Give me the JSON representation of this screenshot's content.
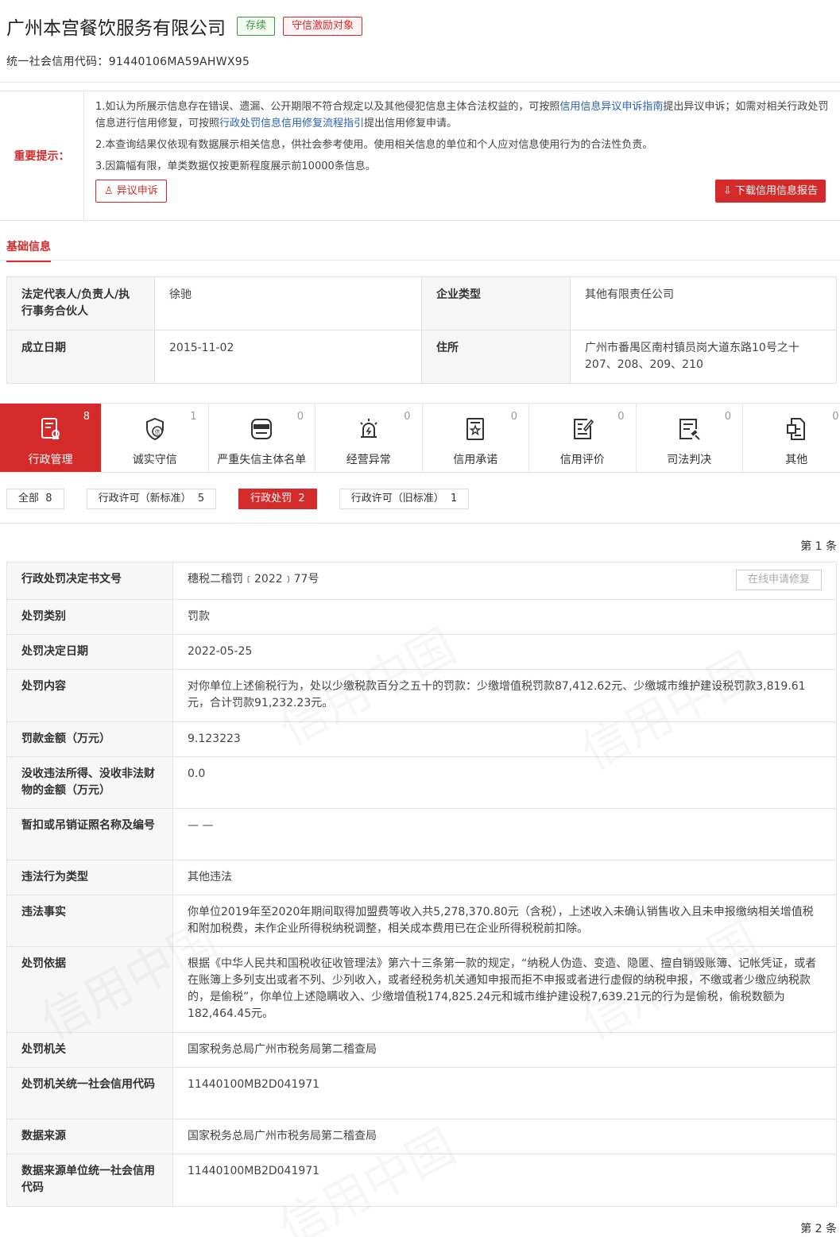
{
  "company": {
    "name": "广州本宫餐饮服务有限公司",
    "status_badge": "存续",
    "honor_badge": "守信激励对象",
    "credit_code": "统一社会信用代码：91440106MA59AHWX95"
  },
  "notice": {
    "label": "重要提示：",
    "p1_a": "1.如认为所展示信息存在错误、遗漏、公开期限不符合规定以及其他侵犯信息主体合法权益的，可按照",
    "p1_link1": "信用信息异议申诉指南",
    "p1_b": "提出异议申诉；如需对相关行政处罚信息进行信用修复，可按照",
    "p1_link2": "行政处罚信息信用修复流程指引",
    "p1_c": "提出信用修复申请。",
    "p2": "2.本查询结果仅依现有数据展示相关信息，供社会参考使用。使用相关信息的单位和个人应对信息使用行为的合法性负责。",
    "p3": "3.因篇幅有限，单类数据仅按更新程度展示前10000条信息。",
    "objection_button": "异议申诉",
    "download_button": "下载信用信息报告"
  },
  "basic": {
    "tab": "基础信息",
    "legal_rep_label": "法定代表人/负责人/执行事务合伙人",
    "legal_rep_value": "徐驰",
    "type_label": "企业类型",
    "type_value": "其他有限责任公司",
    "founded_label": "成立日期",
    "founded_value": "2015-11-02",
    "address_label": "住所",
    "address_value": "广州市番禺区南村镇员岗大道东路10号之十207、208、209、210"
  },
  "categories": [
    {
      "label": "行政管理",
      "count": "8",
      "icon": "admin-icon"
    },
    {
      "label": "诚实守信",
      "count": "1",
      "icon": "honesty-shield-icon"
    },
    {
      "label": "严重失信主体名单",
      "count": "0",
      "icon": "dishonest-list-icon"
    },
    {
      "label": "经营异常",
      "count": "0",
      "icon": "alarm-icon"
    },
    {
      "label": "信用承诺",
      "count": "0",
      "icon": "commitment-icon"
    },
    {
      "label": "信用评价",
      "count": "0",
      "icon": "evaluation-icon"
    },
    {
      "label": "司法判决",
      "count": "0",
      "icon": "judgment-icon"
    },
    {
      "label": "其他",
      "count": "0",
      "icon": "other-icon"
    }
  ],
  "filters": [
    {
      "label": "全部",
      "count": "8"
    },
    {
      "label": "行政许可（新标准）",
      "count": "5"
    },
    {
      "label": "行政处罚",
      "count": "2"
    },
    {
      "label": "行政许可（旧标准）",
      "count": "1"
    }
  ],
  "record": {
    "page_label": "第 1 条",
    "next_page_label": "第 2 条",
    "repair_button": "在线申请修复",
    "rows": [
      {
        "k": "行政处罚决定书文号",
        "v": "穗税二稽罚﹝2022﹞77号"
      },
      {
        "k": "处罚类别",
        "v": "罚款"
      },
      {
        "k": "处罚决定日期",
        "v": "2022-05-25"
      },
      {
        "k": "处罚内容",
        "v": "对你单位上述偷税行为，处以少缴税款百分之五十的罚款：少缴增值税罚款87,412.62元、少缴城市维护建设税罚款3,819.61元，合计罚款91,232.23元。"
      },
      {
        "k": "罚款金额（万元）",
        "v": "9.123223"
      },
      {
        "k": "没收违法所得、没收非法财物的金额（万元）",
        "v": "0.0"
      },
      {
        "k": "暂扣或吊销证照名称及编号",
        "v": "— —"
      },
      {
        "k": "违法行为类型",
        "v": "其他违法"
      },
      {
        "k": "违法事实",
        "v": "你单位2019年至2020年期间取得加盟费等收入共5,278,370.80元（含税），上述收入未确认销售收入且未申报缴纳相关增值税和附加税费，未作企业所得税纳税调整，相关成本费用已在企业所得税税前扣除。"
      },
      {
        "k": "处罚依据",
        "v": "根据《中华人民共和国税收征收管理法》第六十三条第一款的规定，“纳税人伪造、变造、隐匿、擅自销毁账簿、记帐凭证，或者在账簿上多列支出或者不列、少列收入，或者经税务机关通知申报而拒不申报或者进行虚假的纳税申报，不缴或者少缴应纳税款的，是偷税”，你单位上述隐瞒收入、少缴增值税174,825.24元和城市维护建设税7,639.21元的行为是偷税，偷税数额为182,464.45元。"
      },
      {
        "k": "处罚机关",
        "v": "国家税务总局广州市税务局第二稽查局"
      },
      {
        "k": "处罚机关统一社会信用代码",
        "v": "11440100MB2D041971"
      },
      {
        "k": "数据来源",
        "v": "国家税务总局广州市税务局第二稽查局"
      },
      {
        "k": "数据来源单位统一社会信用代码",
        "v": "11440100MB2D041971"
      }
    ]
  },
  "watermark_text": "信用中国",
  "colors": {
    "accent": "#d42a2a",
    "green": "#3a9b3a",
    "link": "#2a62b8"
  }
}
